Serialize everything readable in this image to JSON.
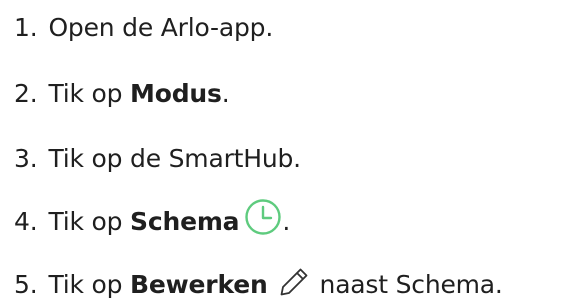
{
  "colors": {
    "text": "#1f1f1f",
    "clock_icon": "#5ecb7e",
    "pencil_icon": "#333333"
  },
  "steps": [
    {
      "number": "1.",
      "text": "Open de Arlo-app."
    },
    {
      "number": "2.",
      "prefix": "Tik op ",
      "bold": "Modus",
      "suffix": "."
    },
    {
      "number": "3.",
      "text": "Tik op de SmartHub."
    },
    {
      "number": "4.",
      "prefix": "Tik op ",
      "bold": "Schema",
      "icon": "clock-icon",
      "suffix": "."
    },
    {
      "number": "5.",
      "prefix": "Tik op ",
      "bold": "Bewerken",
      "icon": "pencil-icon",
      "suffix": "naast Schema."
    }
  ]
}
